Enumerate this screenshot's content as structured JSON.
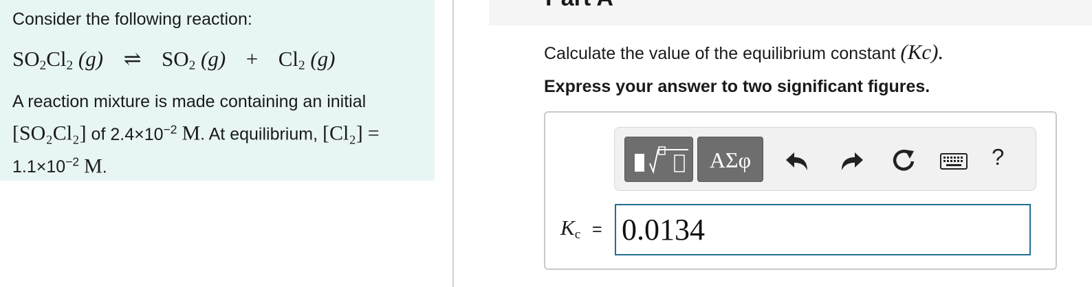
{
  "problem": {
    "intro": "Consider the following reaction:",
    "reaction": {
      "reactant": {
        "formula_parts": [
          "SO",
          "2",
          "Cl",
          "2"
        ],
        "phase": "(g)"
      },
      "arrow": "⇌",
      "products": [
        {
          "formula_parts": [
            "SO",
            "2"
          ],
          "phase": "(g)"
        },
        {
          "formula_parts": [
            "Cl",
            "2"
          ],
          "phase": "(g)"
        }
      ],
      "plus": "+"
    },
    "mixture": {
      "text_a": "A reaction mixture is made containing an initial",
      "so2cl2_bracket": "[SO₂Cl₂]",
      "text_b": "of",
      "initial_conc_mantissa": "2.4×10",
      "initial_conc_exp": "−2",
      "unit": "M",
      "text_c": ". At equilibrium,",
      "cl2_bracket": "[Cl₂]",
      "equals": "=",
      "eq_conc_mantissa": "1.1×10",
      "eq_conc_exp": "−2",
      "unit2": "M",
      "period": "."
    }
  },
  "part": {
    "title": "Part A"
  },
  "question": {
    "text": "Calculate the value of the equilibrium constant",
    "kc_symbol": "(Kc).",
    "instruction": "Express your answer to two significant figures."
  },
  "toolbar": {
    "symbols_label": "ΑΣφ",
    "help_label": "?"
  },
  "answer": {
    "label_k": "K",
    "label_sub": "c",
    "equals": "=",
    "value": "0.0134"
  },
  "colors": {
    "problem_bg": "#e8f5f5",
    "input_border": "#1f6f91",
    "toolbar_button": "#6e6e6e"
  },
  "icons": [
    "templates-icon",
    "undo-icon",
    "redo-icon",
    "reset-icon",
    "keyboard-icon",
    "help-icon"
  ]
}
